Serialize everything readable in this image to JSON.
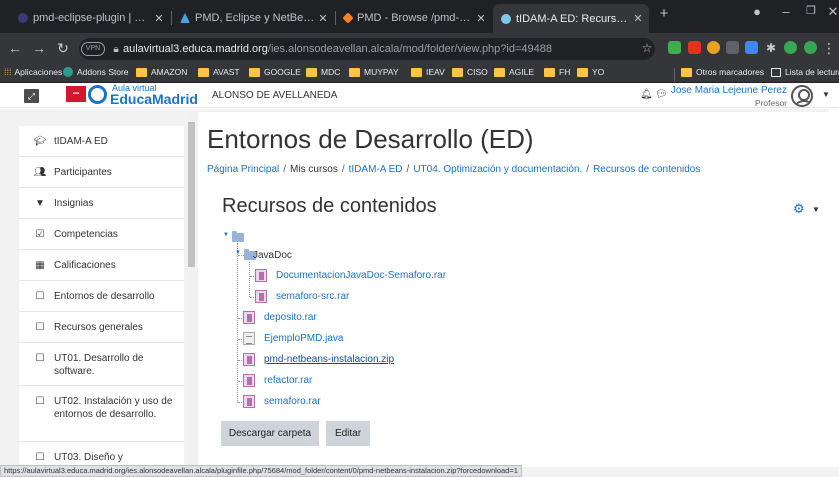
{
  "browser": {
    "tabs": [
      {
        "title": "pmd-eclipse-plugin | Eclipse Plu",
        "icon": "eclipse-icon"
      },
      {
        "title": "PMD, Eclipse y NetBeans - Adictos",
        "icon": "mountain-icon"
      },
      {
        "title": "PMD - Browse /pmd-netbeans at",
        "icon": "sourceforge-icon"
      },
      {
        "title": "tIDAM-A ED: Recursos de conten",
        "icon": "moodle-icon",
        "active": true
      }
    ],
    "new_tab": "+",
    "url_domain": "aulavirtual3.educa.madrid.org",
    "url_path": "/ies.alonsodeavellan.alcala/mod/folder/view.php?id=49488",
    "vpn_label": "VPN",
    "bookmarks": [
      "Aplicaciones",
      "Addons Store",
      "AMAZON",
      "AVAST",
      "GOOGLE",
      "MDC",
      "MUYPAY",
      "IEAV",
      "CISO",
      "AGILE",
      "FH",
      "YO"
    ],
    "other_bookmarks": "Otros marcadores",
    "reading_list": "Lista de lectura",
    "status_url": "https://aulavirtual3.educa.madrid.org/ies.alonsodeavellan.alcala/pluginfile.php/75684/mod_folder/content/0/pmd-netbeans-instalacion.zip?forcedownload=1"
  },
  "navbar": {
    "logo_top": "Aula virtual",
    "logo_bottom": "EducaMadrid",
    "site_name": "ALONSO DE AVELLANEDA",
    "user_name": "Jose Maria Lejeune Perez",
    "user_role": "Profesor"
  },
  "sidebar": {
    "items": [
      {
        "label": "tIDAM-A ED",
        "icon": "graduation-cap-icon"
      },
      {
        "label": "Participantes",
        "icon": "users-icon"
      },
      {
        "label": "Insignias",
        "icon": "shield-icon"
      },
      {
        "label": "Competencias",
        "icon": "check-square-icon"
      },
      {
        "label": "Calificaciones",
        "icon": "table-icon"
      },
      {
        "label": "Entornos de desarrollo",
        "icon": "folder-icon"
      },
      {
        "label": "Recursos generales",
        "icon": "folder-icon"
      },
      {
        "label": "UT01. Desarrollo de software.",
        "icon": "folder-icon"
      },
      {
        "label": "UT02. Instalación y uso de entornos de desarrollo.",
        "icon": "folder-icon"
      },
      {
        "label": "UT03. Diseño y",
        "icon": "folder-icon"
      }
    ]
  },
  "main": {
    "title": "Entornos de Desarrollo (ED)",
    "breadcrumb": [
      {
        "label": "Página Principal",
        "link": true
      },
      {
        "label": "Mis cursos",
        "link": false
      },
      {
        "label": "tIDAM-A ED",
        "link": true
      },
      {
        "label": "UT04. Optimización y documentación.",
        "link": true
      },
      {
        "label": "Recursos de contenidos",
        "link": true
      }
    ],
    "folder_title": "Recursos de contenidos",
    "subfolder": "JavaDoc",
    "subfolder_files": [
      {
        "name": "DocumentacionJavaDoc-Semaforo.rar",
        "type": "rar"
      },
      {
        "name": "semaforo-src.rar",
        "type": "rar"
      }
    ],
    "files": [
      {
        "name": "deposito.rar",
        "type": "rar"
      },
      {
        "name": "EjemploPMD.java",
        "type": "txt"
      },
      {
        "name": "pmd-netbeans-instalacion.zip",
        "type": "rar",
        "hover": true
      },
      {
        "name": "refactor.rar",
        "type": "rar"
      },
      {
        "name": "semaforo.rar",
        "type": "rar"
      }
    ],
    "download_button": "Descargar carpeta",
    "edit_button": "Editar"
  }
}
